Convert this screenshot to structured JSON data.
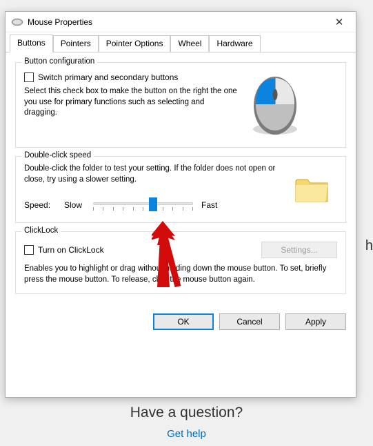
{
  "bg_right_char": "h",
  "window": {
    "title": "Mouse Properties"
  },
  "tabs": [
    "Buttons",
    "Pointers",
    "Pointer Options",
    "Wheel",
    "Hardware"
  ],
  "active_tab_index": 0,
  "button_config": {
    "legend": "Button configuration",
    "checkbox_label": "Switch primary and secondary buttons",
    "checked": false,
    "desc": "Select this check box to make the button on the right the one you use for primary functions such as selecting and dragging."
  },
  "double_click": {
    "legend": "Double-click speed",
    "desc": "Double-click the folder to test your setting. If the folder does not open or close, try using a slower setting.",
    "speed_label": "Speed:",
    "slow_label": "Slow",
    "fast_label": "Fast",
    "value_percent": 60
  },
  "clicklock": {
    "legend": "ClickLock",
    "checkbox_label": "Turn on ClickLock",
    "checked": false,
    "settings_button": "Settings...",
    "settings_enabled": false,
    "desc": "Enables you to highlight or drag without holding down the mouse button. To set, briefly press the mouse button. To release, click the mouse button again."
  },
  "dialog_buttons": {
    "ok": "OK",
    "cancel": "Cancel",
    "apply": "Apply"
  },
  "annotation": {
    "type": "red-arrow",
    "points_to": "double-click-speed-slider"
  },
  "footer": {
    "question": "Have a question?",
    "link": "Get help"
  }
}
